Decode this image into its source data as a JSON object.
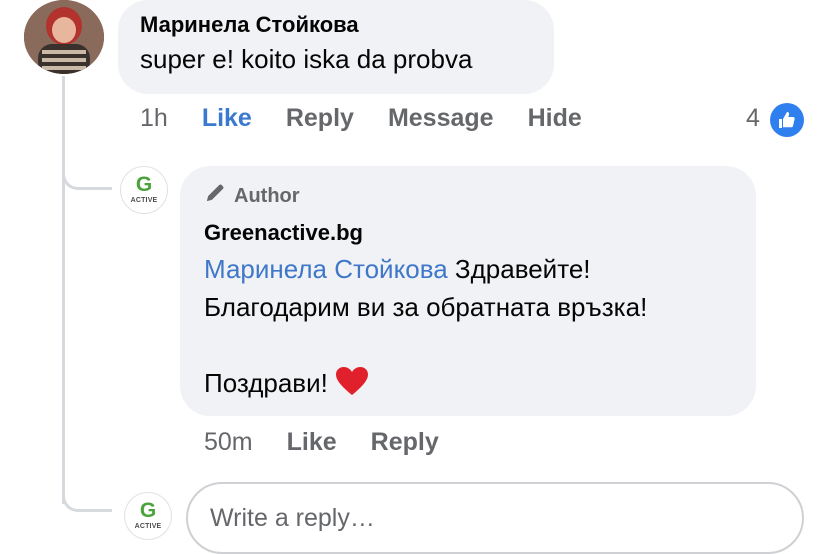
{
  "comment": {
    "author_name": "Маринела Стойкова",
    "text": "super e! koito iska da probva",
    "time": "1h",
    "actions": {
      "like": "Like",
      "reply": "Reply",
      "message": "Message",
      "hide": "Hide"
    },
    "reaction_count": "4"
  },
  "reply": {
    "author_badge": "Author",
    "author_name": "Greenactive.bg",
    "mention": "Маринела Стойкова",
    "greeting": " Здравейте!",
    "line2": "Благодарим ви за обратната връзка!",
    "closing": "Поздрави!",
    "emoji": "❤️",
    "time": "50m",
    "actions": {
      "like": "Like",
      "reply": "Reply"
    }
  },
  "brand_logo": {
    "letter": "G",
    "wordmark": "ACTIVE"
  },
  "reply_box": {
    "placeholder": "Write a reply…"
  },
  "colors": {
    "like_blue": "#3a79cf",
    "bubble_bg": "#f0f2f5",
    "brand_green": "#4aa33a",
    "mention": "#3f77c9"
  }
}
